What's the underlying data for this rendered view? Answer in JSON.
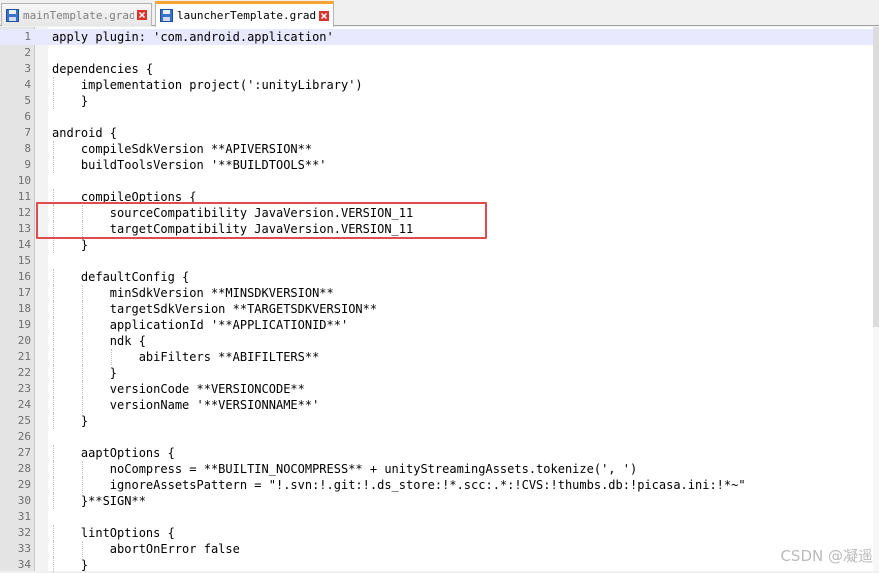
{
  "tabs": [
    {
      "label": "mainTemplate.gradle",
      "active": false
    },
    {
      "label": "launcherTemplate.gradle",
      "active": true
    }
  ],
  "editor": {
    "current_line": 1,
    "lines": [
      "apply plugin: 'com.android.application'",
      "",
      "dependencies {",
      "    implementation project(':unityLibrary')",
      "    }",
      "",
      "android {",
      "    compileSdkVersion **APIVERSION**",
      "    buildToolsVersion '**BUILDTOOLS**'",
      "",
      "    compileOptions {",
      "        sourceCompatibility JavaVersion.VERSION_11",
      "        targetCompatibility JavaVersion.VERSION_11",
      "    }",
      "",
      "    defaultConfig {",
      "        minSdkVersion **MINSDKVERSION**",
      "        targetSdkVersion **TARGETSDKVERSION**",
      "        applicationId '**APPLICATIONID**'",
      "        ndk {",
      "            abiFilters **ABIFILTERS**",
      "        }",
      "        versionCode **VERSIONCODE**",
      "        versionName '**VERSIONNAME**'",
      "    }",
      "",
      "    aaptOptions {",
      "        noCompress = **BUILTIN_NOCOMPRESS** + unityStreamingAssets.tokenize(', ')",
      "        ignoreAssetsPattern = \"!.svn:!.git:!.ds_store:!*.scc:.*:!CVS:!thumbs.db:!picasa.ini:!*~\"",
      "    }**SIGN**",
      "",
      "    lintOptions {",
      "        abortOnError false",
      "    }"
    ]
  },
  "highlight": {
    "lines": [
      12,
      13
    ],
    "color": "#e14b4b"
  },
  "watermark": "CSDN @凝遥",
  "colors": {
    "active_tab_accent": "#f7a330",
    "close_icon": "#d9342b",
    "current_line": "#e8e8ff"
  }
}
